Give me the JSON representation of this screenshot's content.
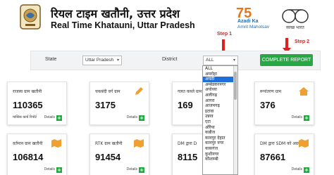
{
  "header": {
    "title_hindi": "रियल टाइम खतौनी, उत्तर प्रदेश",
    "title_english": "Real Time Khatauni, Uttar Pradesh",
    "azadi_number": "75",
    "azadi_line1": "Azadi Ka",
    "azadi_line2": "Amrit Mahotsav",
    "swachh_text": "स्वच्छ भारत"
  },
  "steps": {
    "step1": "Step 1",
    "step2": "Step 2"
  },
  "filters": {
    "state_label": "State",
    "state_value": "Uttar Pradesh",
    "district_label": "District",
    "district_value": "ALL",
    "report_button": "COMPLETE REPORT"
  },
  "district_dropdown": {
    "options": [
      "ALL",
      "अमरोहा",
      "अमेठी",
      "अम्बेडकरनगर",
      "अयोध्या",
      "अलीगढ़",
      "आगरा",
      "आजमगढ़",
      "इटावा",
      "उन्नाव",
      "एटा",
      "औरैया",
      "कन्नौज",
      "कानपुर देहात",
      "कानपुर नगर",
      "कासगंज",
      "कुशीनगर",
      "कौशाम्बी"
    ],
    "selected_index": 2
  },
  "cards": [
    {
      "title": "राजस्व ग्राम खतौनी",
      "value": "110365",
      "sub": "मासिक कार्य रिपोर्ट",
      "details": "Details"
    },
    {
      "title": "चकबंदी वर्ग ग्राम",
      "value": "3175",
      "sub": "",
      "details": "Details"
    },
    {
      "title": "गलत कब्जे ग्राम",
      "value": "169",
      "sub": "",
      "details": ""
    },
    {
      "title": "रूपांतरण ग्राम",
      "value": "376",
      "sub": "",
      "details": "Details"
    },
    {
      "title": "वर्तमान ग्राम खतौनी",
      "value": "106814",
      "sub": "",
      "details": "Details"
    },
    {
      "title": "RTK ग्राम खतौनी",
      "value": "91454",
      "sub": "",
      "details": "Details"
    },
    {
      "title": "DM द्वारा D",
      "value": "8115",
      "sub": "",
      "details": ""
    },
    {
      "title": "DM द्वारा SDM को अग्रसारित",
      "value": "87661",
      "sub": "",
      "details": "Details"
    }
  ],
  "colors": {
    "report_green": "#28a745",
    "step_red": "#dd2222",
    "icon_orange": "#f0a030",
    "dropdown_highlight": "#1e6fd9"
  }
}
